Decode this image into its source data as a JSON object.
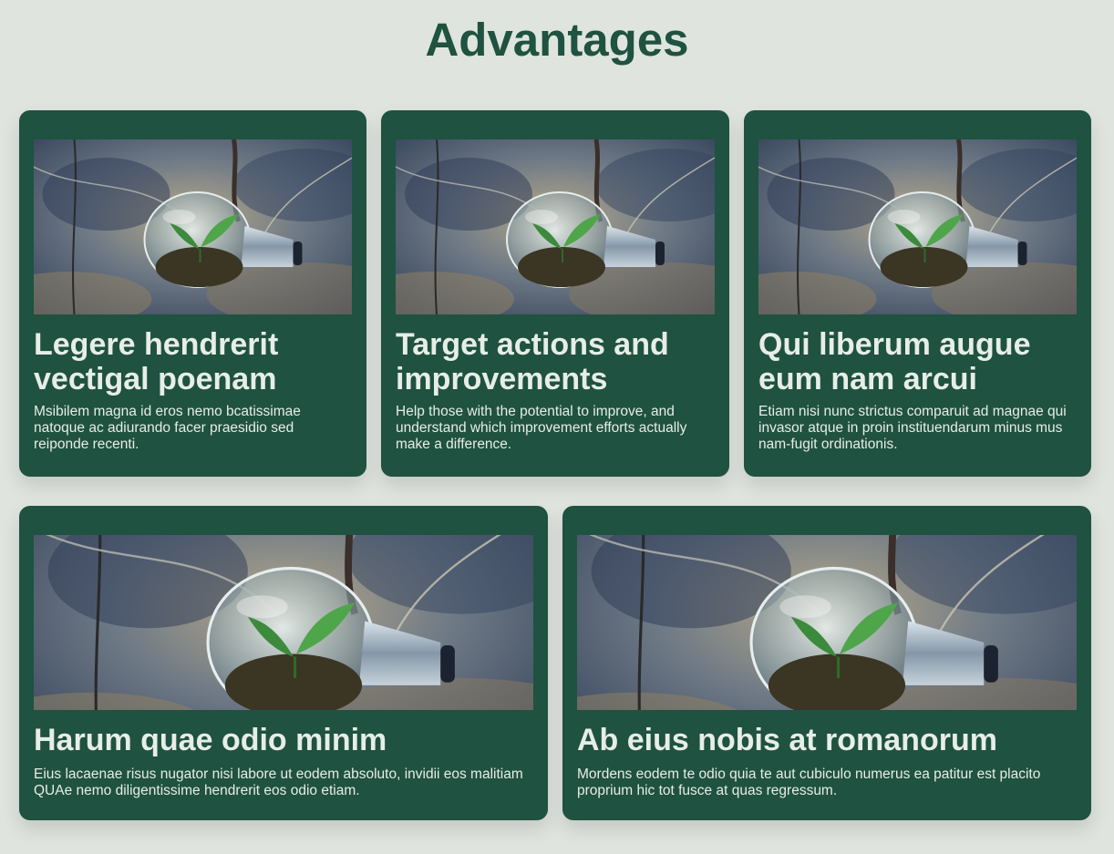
{
  "page": {
    "title": "Advantages",
    "colors": {
      "background": "#dfe4df",
      "card": "#1f5240",
      "title": "#1f5240",
      "card_text": "#e7ede7"
    }
  },
  "cards": [
    {
      "title": "Legere hendrerit vectigal poenam",
      "text": "Msibilem magna id eros nemo bcatissimae natoque ac adiurando facer praesidio sed reiponde recenti.",
      "image": "lightbulb-seedling-photo"
    },
    {
      "title": "Target actions and improvements",
      "text": "Help those with the potential to improve, and understand which improvement efforts actually make a difference.",
      "image": "lightbulb-seedling-photo"
    },
    {
      "title": "Qui liberum augue eum nam arcui",
      "text": "Etiam nisi nunc strictus comparuit ad magnae qui invasor atque in proin instituendarum minus mus nam-fugit ordinationis.",
      "image": "lightbulb-seedling-photo"
    },
    {
      "title": "Harum quae odio minim",
      "text": "Eius lacaenae risus nugator nisi labore ut eodem absoluto, invidii eos malitiam QUAe nemo diligentissime hendrerit eos odio etiam.",
      "image": "lightbulb-seedling-photo"
    },
    {
      "title": "Ab eius nobis at romanorum",
      "text": "Mordens eodem te odio quia te aut cubiculo numerus ea patitur est placito proprium hic tot fusce at quas regressum.",
      "image": "lightbulb-seedling-photo"
    }
  ]
}
